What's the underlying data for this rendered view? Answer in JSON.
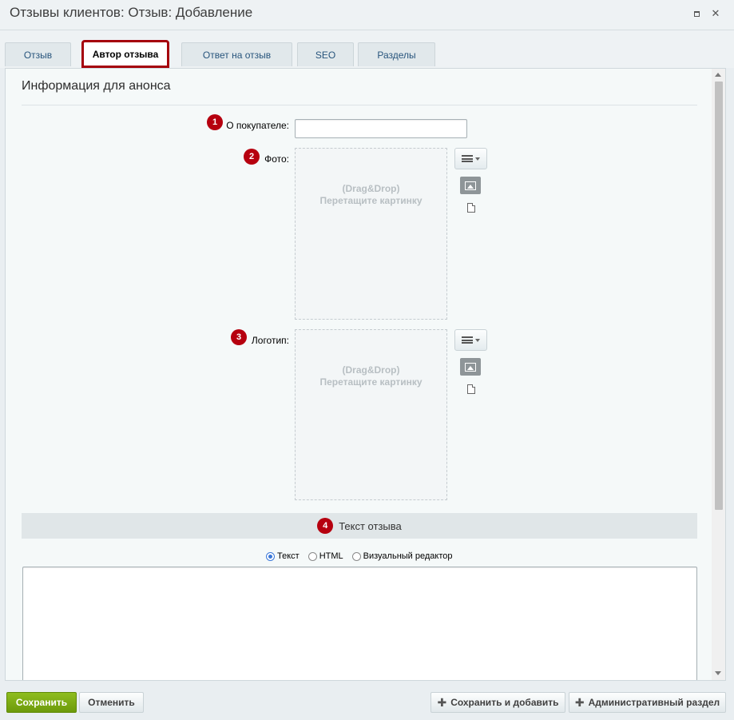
{
  "window": {
    "title": "Отзывы клиентов: Отзыв: Добавление",
    "maximize_icon": "maximize-icon",
    "close_icon": "close-icon",
    "close_glyph": "✕"
  },
  "tabs": [
    {
      "label": "Отзыв",
      "active": false
    },
    {
      "label": "Автор отзыва",
      "active": true
    },
    {
      "label": "Ответ на отзыв",
      "active": false
    },
    {
      "label": "SEO",
      "active": false
    },
    {
      "label": "Разделы",
      "active": false
    }
  ],
  "section": {
    "title": "Информация для анонса"
  },
  "fields": {
    "customer": {
      "badge": "1",
      "label": "О покупателе:",
      "value": ""
    },
    "photo": {
      "badge": "2",
      "label": "Фото:",
      "drop_line1": "(Drag&Drop)",
      "drop_line2": "Перетащите картинку"
    },
    "logo": {
      "badge": "3",
      "label": "Логотип:",
      "drop_line1": "(Drag&Drop)",
      "drop_line2": "Перетащите картинку"
    }
  },
  "review_text": {
    "badge": "4",
    "header": "Текст отзыва",
    "modes": [
      {
        "label": "Текст",
        "checked": true
      },
      {
        "label": "HTML",
        "checked": false
      },
      {
        "label": "Визуальный редактор",
        "checked": false
      }
    ],
    "value": ""
  },
  "footer": {
    "save": "Сохранить",
    "cancel": "Отменить",
    "save_add": "Сохранить и добавить",
    "admin": "Административный раздел",
    "plus_glyph": "✚"
  },
  "colors": {
    "accent_badge": "#b6000f",
    "active_tab_outline": "#a5000c",
    "save_button": "#7aaa12",
    "link_tab": "#27547c"
  }
}
